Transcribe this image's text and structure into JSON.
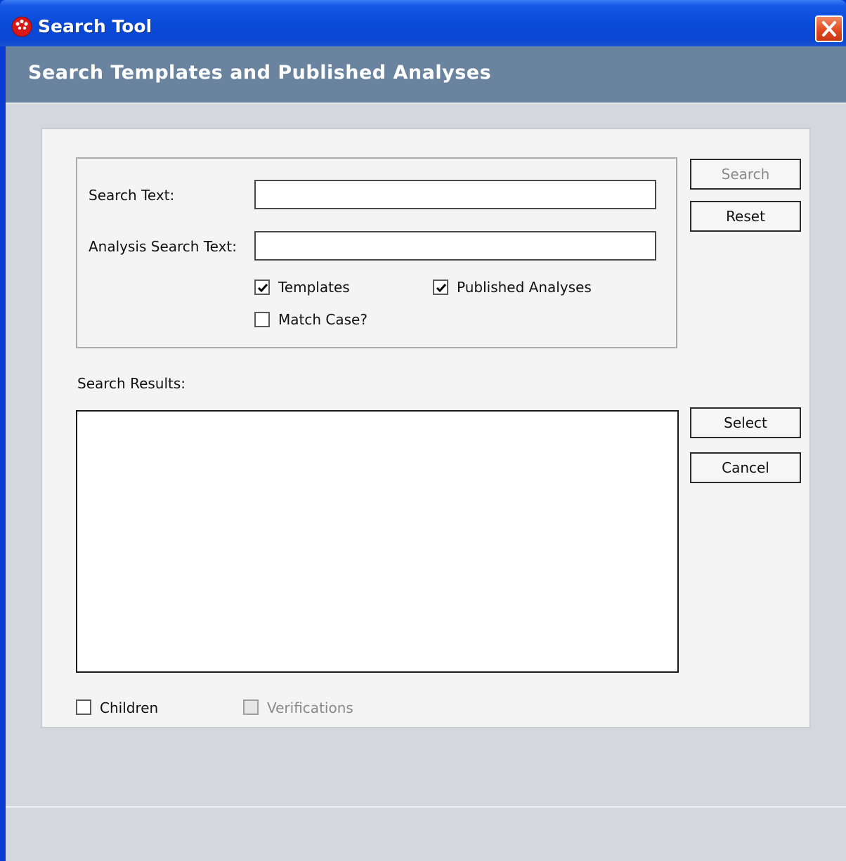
{
  "window": {
    "title": "Search Tool",
    "app_icon": "red-dots-app-icon",
    "close_icon": "close-x-icon"
  },
  "header": {
    "title": "Search Templates and Published Analyses"
  },
  "form": {
    "search_text_label": "Search Text:",
    "search_text_value": "",
    "analysis_search_text_label": "Analysis Search Text:",
    "analysis_search_text_value": "",
    "templates_label": "Templates",
    "templates_checked": true,
    "published_analyses_label": "Published Analyses",
    "published_analyses_checked": true,
    "match_case_label": "Match Case?",
    "match_case_checked": false
  },
  "buttons": {
    "search": "Search",
    "reset": "Reset",
    "select": "Select",
    "cancel": "Cancel"
  },
  "results": {
    "label": "Search Results:",
    "items": []
  },
  "options": {
    "children_label": "Children",
    "children_checked": false,
    "verifications_label": "Verifications",
    "verifications_checked": false,
    "verifications_enabled": false
  }
}
